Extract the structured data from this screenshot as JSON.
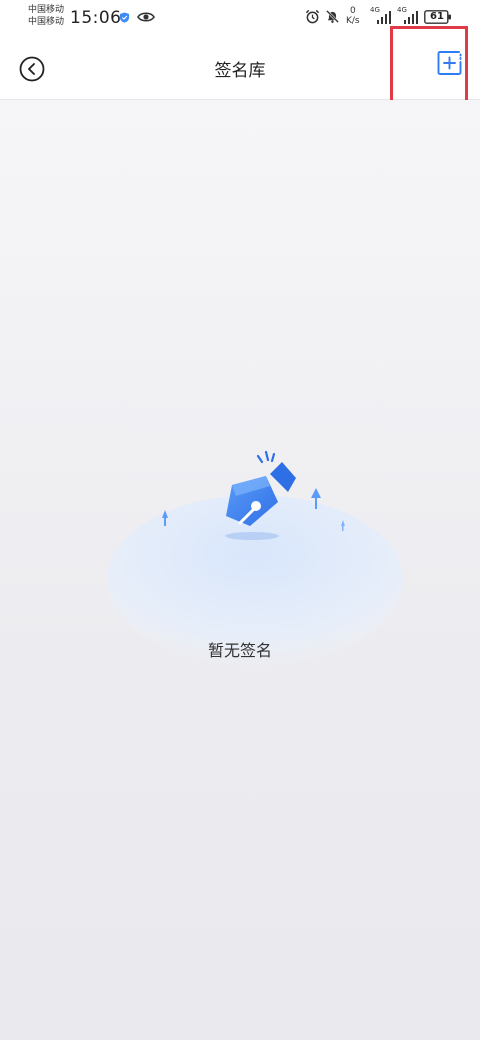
{
  "status_bar": {
    "carrier_1": "中国移动",
    "carrier_2": "中国移动",
    "time": "15:06",
    "speed_value": "0",
    "speed_unit": "K/s",
    "net_1": "4G",
    "net_2": "4G",
    "battery": "61"
  },
  "header": {
    "title": "签名库"
  },
  "empty_state": {
    "text": "暂无签名"
  },
  "colors": {
    "accent": "#2f7df6",
    "highlight_box": "#e03a46"
  }
}
